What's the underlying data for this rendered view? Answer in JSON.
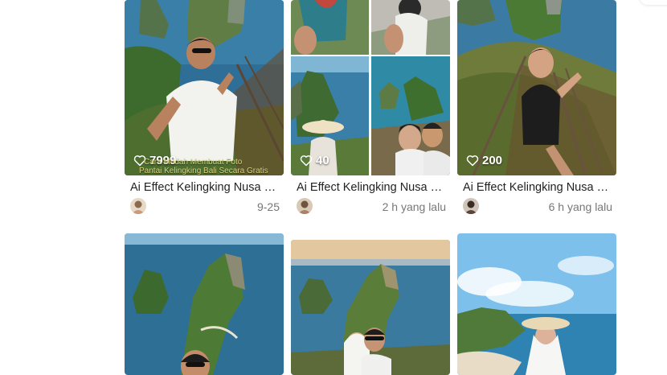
{
  "cards": [
    {
      "likes": "7999",
      "title": "Ai Effect Kelingking Nusa Pe...",
      "time": "9-25",
      "watermark_line1": "Cara Mudah Membuat Foto",
      "watermark_line2": "Pantai Kelingking Bali Secara Gratis"
    },
    {
      "likes": "40",
      "title": "Ai Effect Kelingking Nusa Pe...",
      "time": "2 h yang lalu"
    },
    {
      "likes": "200",
      "title": "Ai Effect Kelingking Nusa Pe...",
      "time": "6 h yang lalu"
    }
  ],
  "icons": {
    "like": "heart-icon",
    "avatar": "user-avatar"
  },
  "colors": {
    "title_text": "#222222",
    "time_text": "#777777",
    "like_text": "#ffffff",
    "sea": "#2f6e96",
    "sky": "#7ec0ec",
    "cliff": "#4f7a3a"
  }
}
